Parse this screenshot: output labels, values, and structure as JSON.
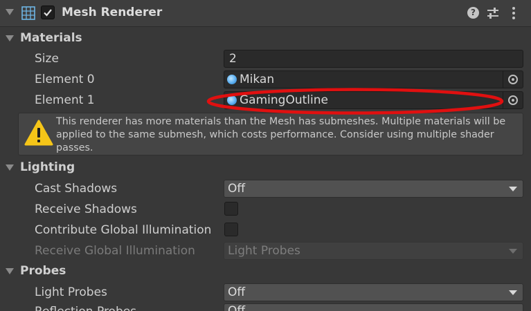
{
  "component": {
    "title": "Mesh Renderer",
    "enabled": true,
    "icons": {
      "component": "mesh-renderer-icon",
      "help": "help-icon",
      "presets": "presets-sliders-icon",
      "menu": "kebab-menu-icon"
    },
    "help_glyph": "?"
  },
  "materials": {
    "title": "Materials",
    "size_label": "Size",
    "size_value": "2",
    "elements": [
      {
        "label": "Element 0",
        "value": "Mikan"
      },
      {
        "label": "Element 1",
        "value": "GamingOutline"
      }
    ],
    "warning": "This renderer has more materials than the Mesh has submeshes. Multiple materials will be applied to the same submesh, which costs performance. Consider using multiple shader passes."
  },
  "lighting": {
    "title": "Lighting",
    "cast_shadows_label": "Cast Shadows",
    "cast_shadows_value": "Off",
    "receive_shadows_label": "Receive Shadows",
    "receive_shadows_checked": false,
    "contribute_gi_label": "Contribute Global Illumination",
    "contribute_gi_checked": false,
    "receive_gi_label": "Receive Global Illumination",
    "receive_gi_value": "Light Probes"
  },
  "probes": {
    "title": "Probes",
    "light_probes_label": "Light Probes",
    "light_probes_value": "Off",
    "reflection_probes_label": "Reflection Probes",
    "reflection_probes_value": "Off"
  },
  "colors": {
    "background": "#383838",
    "field": "#2a2a2a",
    "dropdown": "#515151",
    "annotation": "#e01010",
    "warning": "#f5c518"
  }
}
